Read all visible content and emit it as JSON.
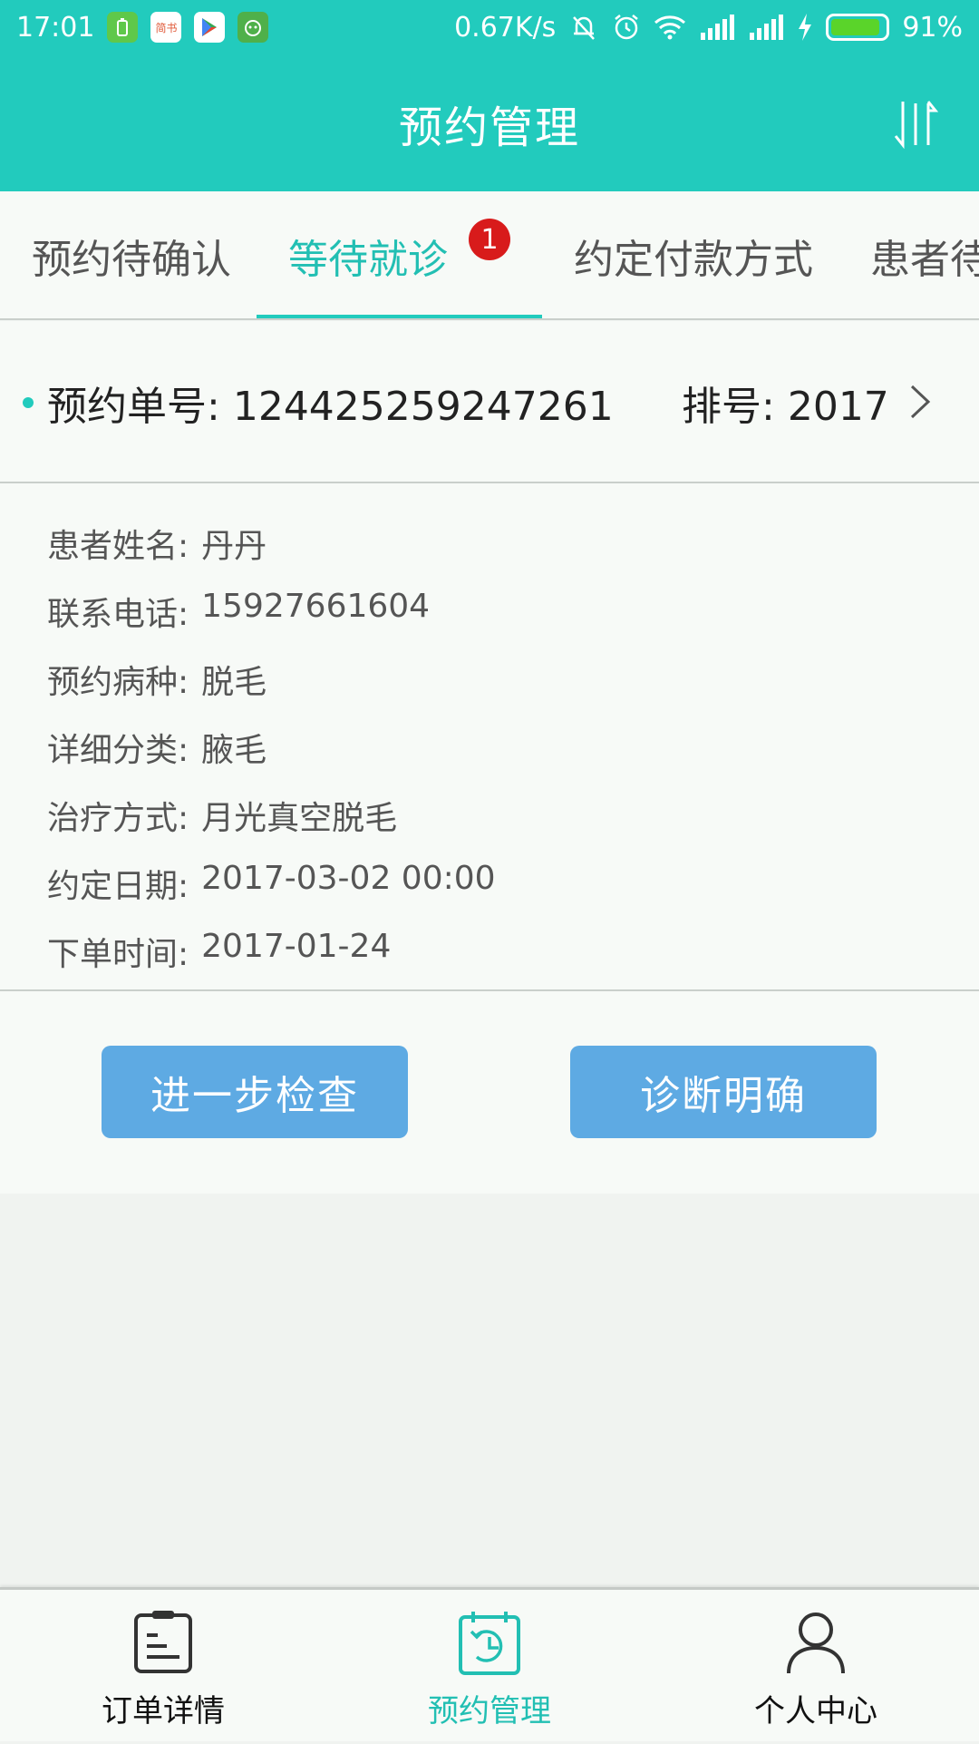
{
  "status_bar": {
    "time": "17:01",
    "apps": [
      {
        "icon": "battery-app-icon",
        "color": "#5fc84a"
      },
      {
        "icon": "jianshu-app-icon",
        "label": "简书",
        "color": "#ffffff"
      },
      {
        "icon": "play-store-icon",
        "color": "#ffffff"
      },
      {
        "icon": "android-app-icon",
        "color": "#4fb04a"
      }
    ],
    "network_speed": "0.67K/s",
    "battery_percent": "91%",
    "battery_level": 0.91
  },
  "header": {
    "title": "预约管理"
  },
  "tabs": [
    {
      "label": "预约待确认",
      "active": false
    },
    {
      "label": "等待就诊",
      "active": true,
      "badge": "1"
    },
    {
      "label": "约定付款方式",
      "active": false
    },
    {
      "label": "患者待",
      "active": false
    }
  ],
  "order": {
    "number_label": "预约单号:",
    "number": "124425259247261",
    "queue_label": "排号:",
    "queue": "2017"
  },
  "details": [
    {
      "label": "患者姓名:",
      "value": "丹丹"
    },
    {
      "label": "联系电话:",
      "value": "15927661604"
    },
    {
      "label": "预约病种:",
      "value": "脱毛"
    },
    {
      "label": "详细分类:",
      "value": "腋毛"
    },
    {
      "label": "治疗方式:",
      "value": "月光真空脱毛"
    },
    {
      "label": "约定日期:",
      "value": "2017-03-02 00:00"
    },
    {
      "label": "下单时间:",
      "value": "2017-01-24"
    }
  ],
  "actions": {
    "further_check": "进一步检查",
    "diagnosis_clear": "诊断明确"
  },
  "bottom_nav": [
    {
      "label": "订单详情",
      "icon": "clipboard-icon",
      "active": false
    },
    {
      "label": "预约管理",
      "icon": "calendar-clock-icon",
      "active": true
    },
    {
      "label": "个人中心",
      "icon": "user-icon",
      "active": false
    }
  ],
  "colors": {
    "primary": "#22cbbd",
    "button": "#5eaae3",
    "badge": "#d81b1b"
  }
}
